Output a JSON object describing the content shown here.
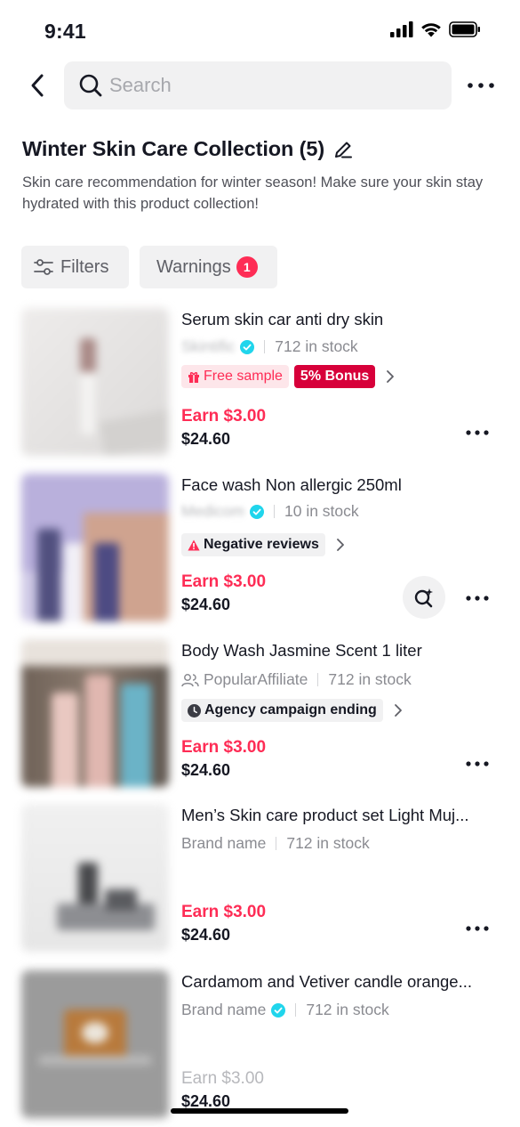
{
  "status": {
    "time": "9:41"
  },
  "search": {
    "placeholder": "Search",
    "value": ""
  },
  "collection": {
    "title": "Winter Skin Care Collection (5)",
    "description": "Skin care recommendation for winter season! Make sure your skin stay hydrated with this product collection!"
  },
  "filters": {
    "filters_label": "Filters",
    "warnings_label": "Warnings",
    "warnings_count": "1"
  },
  "products": [
    {
      "name": "Serum skin car anti dry skin",
      "seller": "Skintific",
      "stock": "712 in stock",
      "tags": [
        "Free sample",
        "5% Bonus"
      ],
      "earn": "Earn $3.00",
      "price": "$24.60"
    },
    {
      "name": "Face wash Non allergic 250ml",
      "seller": "Medicom",
      "stock": "10 in stock",
      "tags": [
        "Negative reviews"
      ],
      "earn": "Earn $3.00",
      "price": "$24.60"
    },
    {
      "name": "Body Wash Jasmine Scent 1 liter",
      "seller": "PopularAffiliate",
      "stock": "712 in stock",
      "tags": [
        "Agency campaign ending"
      ],
      "earn": "Earn $3.00",
      "price": "$24.60"
    },
    {
      "name": "Men’s Skin care product set Light Muj...",
      "seller": "Brand name",
      "stock": "712 in stock",
      "tags": [],
      "earn": "Earn $3.00",
      "price": "$24.60"
    },
    {
      "name": "Cardamom and Vetiver candle orange...",
      "seller": "Brand name",
      "stock": "712 in stock",
      "tags": [],
      "earn": "Earn $3.00",
      "price": "$24.60"
    }
  ],
  "colors": {
    "accent": "#fe2c55",
    "bonus": "#d7003a",
    "verified": "#20d5ec",
    "chip_bg": "#f1f1f2"
  }
}
